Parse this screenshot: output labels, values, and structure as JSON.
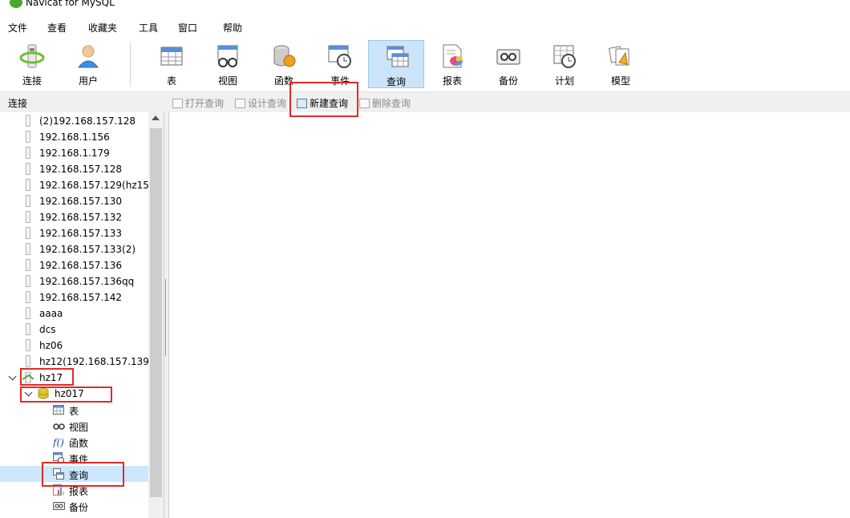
{
  "app": {
    "title": "Navicat for MySQL"
  },
  "menu": [
    "文件",
    "查看",
    "收藏夹",
    "工具",
    "窗口",
    "帮助"
  ],
  "toolbar": {
    "left": [
      {
        "label": "连接",
        "icon": "connection-icon"
      },
      {
        "label": "用户",
        "icon": "user-icon"
      }
    ],
    "main": [
      {
        "label": "表",
        "icon": "table-icon"
      },
      {
        "label": "视图",
        "icon": "view-icon"
      },
      {
        "label": "函数",
        "icon": "function-icon"
      },
      {
        "label": "事件",
        "icon": "event-icon"
      },
      {
        "label": "查询",
        "icon": "query-icon",
        "active": true
      },
      {
        "label": "报表",
        "icon": "report-icon"
      },
      {
        "label": "备份",
        "icon": "backup-icon"
      },
      {
        "label": "计划",
        "icon": "schedule-icon"
      },
      {
        "label": "模型",
        "icon": "model-icon"
      }
    ]
  },
  "subbar": {
    "connection_label": "连接",
    "buttons": [
      {
        "label": "打开查询",
        "enabled": false
      },
      {
        "label": "设计查询",
        "enabled": false
      },
      {
        "label": "新建查询",
        "enabled": true
      },
      {
        "label": "删除查询",
        "enabled": false
      }
    ]
  },
  "tree": {
    "connections": [
      "(2)192.168.157.128",
      "192.168.1.156",
      "192.168.1.179",
      "192.168.157.128",
      "192.168.157.129(hz15)",
      "192.168.157.130",
      "192.168.157.132",
      "192.168.157.133",
      "192.168.157.133(2)",
      "192.168.157.136",
      "192.168.157.136qq",
      "192.168.157.142",
      "aaaa",
      "dcs",
      "hz06",
      "hz12(192.168.157.139)"
    ],
    "open_connection": "hz17",
    "database": "hz017",
    "objects": [
      {
        "label": "表",
        "icon": "table-icon"
      },
      {
        "label": "视图",
        "icon": "view-icon"
      },
      {
        "label": "函数",
        "icon": "function-icon"
      },
      {
        "label": "事件",
        "icon": "event-icon"
      },
      {
        "label": "查询",
        "icon": "query-icon",
        "selected": true
      },
      {
        "label": "报表",
        "icon": "report-icon"
      },
      {
        "label": "备份",
        "icon": "backup-icon"
      }
    ]
  },
  "colors": {
    "highlight_box": "#e02a2a",
    "active_tool": "#cce4f7",
    "selected_row": "#cce8ff"
  }
}
